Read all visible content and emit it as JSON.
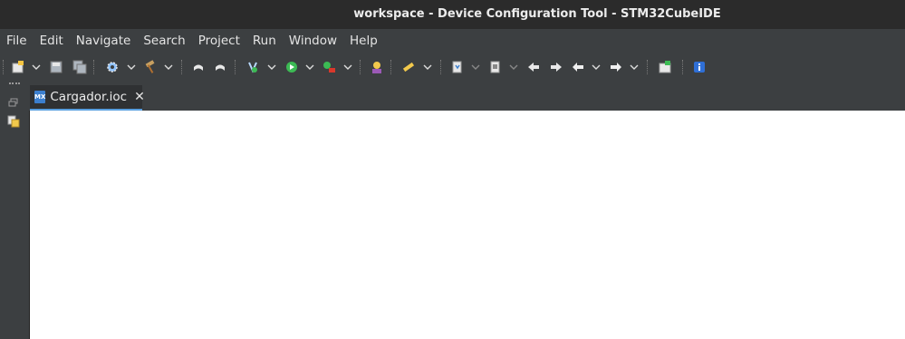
{
  "window": {
    "title": "workspace - Device Configuration Tool - STM32CubeIDE"
  },
  "menubar": {
    "items": [
      "File",
      "Edit",
      "Navigate",
      "Search",
      "Project",
      "Run",
      "Window",
      "Help"
    ]
  },
  "toolbar": {
    "icons": [
      "new-icon",
      "save-icon",
      "save-all-icon",
      "settings-icon",
      "build-icon",
      "undo-icon",
      "redo-icon",
      "debug-icon",
      "run-icon",
      "external-tools-icon",
      "profile-icon",
      "marker-icon",
      "import-icon",
      "export-icon",
      "previous-annotation-icon",
      "next-annotation-icon",
      "back-icon",
      "forward-icon",
      "device-config-icon",
      "info-icon"
    ]
  },
  "editor": {
    "tabs": [
      {
        "label": "Cargador.ioc",
        "icon_text": "MX",
        "icon": "mx-icon"
      }
    ]
  },
  "colors": {
    "accent": "#5aa0e0",
    "background": "#3c3f41",
    "editor": "#ffffff"
  }
}
